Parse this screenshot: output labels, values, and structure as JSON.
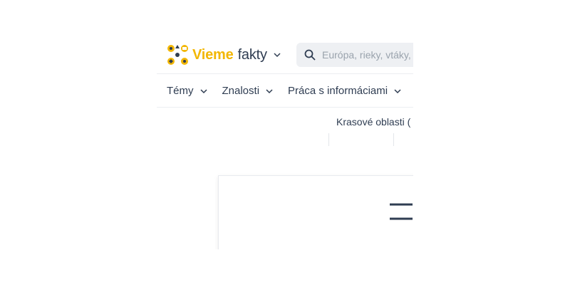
{
  "header": {
    "logo_word1": "Vieme",
    "logo_word2": "fakty",
    "search_placeholder": "Európa, rieky, vtáky, zvieratá..."
  },
  "nav": {
    "items": [
      {
        "label": "Témy"
      },
      {
        "label": "Znalosti"
      },
      {
        "label": "Práca s informáciami"
      }
    ]
  },
  "content": {
    "breadcrumb_text": "Krasové oblasti ("
  },
  "colors": {
    "brand_yellow": "#f2b705",
    "text_dark": "#2f3d52",
    "placeholder": "#9aa3ad",
    "search_bg": "#eef0f3"
  },
  "icons": [
    "logo-icon",
    "chevron-down-icon",
    "search-icon",
    "graphic-icon"
  ]
}
